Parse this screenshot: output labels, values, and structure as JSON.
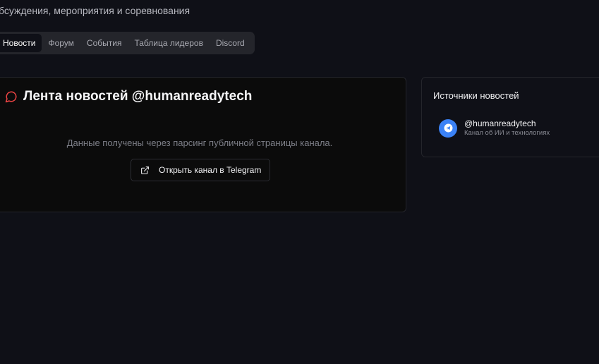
{
  "header": {
    "subtitle": "бсуждения, мероприятия и соревнования"
  },
  "tabs": [
    {
      "label": "Новости",
      "active": true
    },
    {
      "label": "Форум",
      "active": false
    },
    {
      "label": "События",
      "active": false
    },
    {
      "label": "Таблица лидеров",
      "active": false
    },
    {
      "label": "Discord",
      "active": false
    }
  ],
  "feed": {
    "icon": "message-circle-icon",
    "title": "Лента новостей @humanreadytech",
    "note": "Данные получены через парсинг публичной страницы канала.",
    "button_icon": "external-link-icon",
    "button_label": "Открыть канал в Telegram"
  },
  "sources": {
    "title": "Источники новостей",
    "items": [
      {
        "icon": "telegram-icon",
        "name": "@humanreadytech",
        "description": "Канал об ИИ и технологиях"
      }
    ]
  },
  "colors": {
    "background": "#0f1017",
    "accent_red": "#ef4444",
    "telegram_blue": "#3b82f6"
  }
}
